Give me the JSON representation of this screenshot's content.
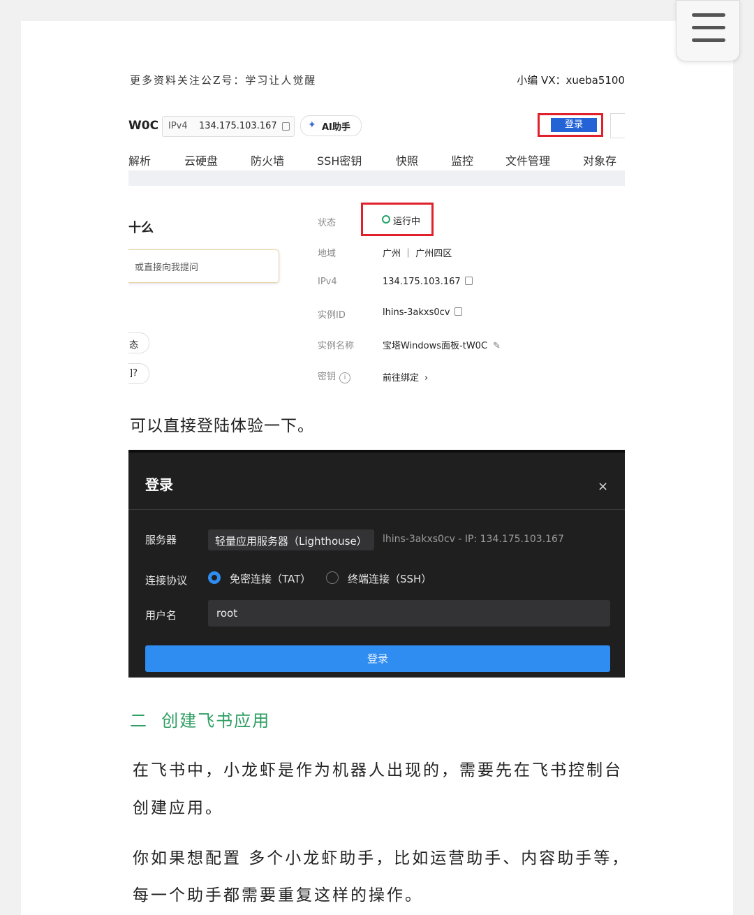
{
  "header": {
    "left": "更多资料关注公Z号：学习让人觉醒",
    "right": "小编 VX：xueba5100"
  },
  "console": {
    "instance_short": "W0C",
    "ipv4_tag": "IPv4",
    "ipv4_value": "134.175.103.167",
    "ai_button": "AI助手",
    "login_button": "登录",
    "tabs": [
      "解析",
      "云硬盘",
      "防火墙",
      "SSH密钥",
      "快照",
      "监控",
      "文件管理",
      "对象存储"
    ],
    "left_heading": "十么",
    "ask_placeholder": "或直接向我提问",
    "chips": [
      "态",
      "]?"
    ],
    "details": [
      {
        "label": "状态",
        "value": "运行中"
      },
      {
        "label": "地域",
        "value": "广州 ｜ 广州四区"
      },
      {
        "label": "IPv4",
        "value": "134.175.103.167"
      },
      {
        "label": "实例ID",
        "value": "lhins-3akxs0cv"
      },
      {
        "label": "实例名称",
        "value": "宝塔Windows面板-tW0C"
      },
      {
        "label": "密钥",
        "value": "前往绑定"
      }
    ],
    "status_color": "#21a36a"
  },
  "text1": "可以直接登陆体验一下。",
  "login_dialog": {
    "title": "登录",
    "close": "×",
    "server_label": "服务器",
    "server_type": "轻量应用服务器（Lighthouse）",
    "server_info": "lhins-3akxs0cv - IP: 134.175.103.167",
    "protocol_label": "连接协议",
    "protocol_options": [
      "免密连接（TAT）",
      "终端连接（SSH）"
    ],
    "selected_protocol": "免密连接（TAT）",
    "username_label": "用户名",
    "username_value": "root",
    "submit": "登录",
    "accent": "#2f8cf0"
  },
  "section": {
    "heading": "二  创建飞书应用",
    "color": "#2f9e63"
  },
  "paragraphs": [
    "在飞书中，小龙虾是作为机器人出现的，需要先在飞书控制台",
    "创建应用。",
    "你如果想配置 多个小龙虾助手，比如运营助手、内容助手等，",
    "每一个助手都需要重复这样的操作。"
  ]
}
